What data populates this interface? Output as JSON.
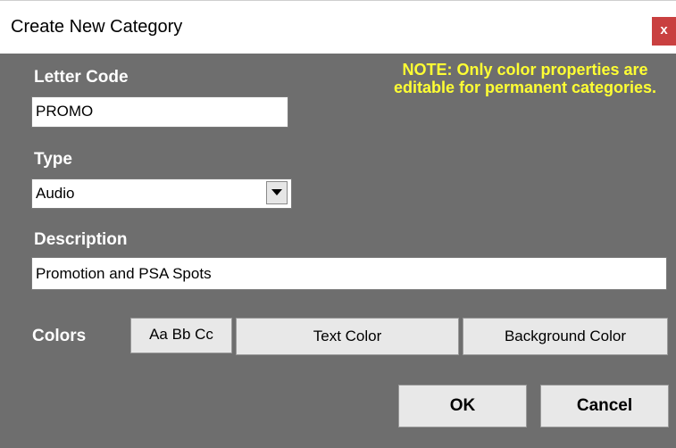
{
  "window": {
    "title": "Create New Category",
    "close_label": "x"
  },
  "form": {
    "letter_code_label": "Letter Code",
    "letter_code_value": "PROMO",
    "note": "NOTE: Only color properties are editable for permanent categories.",
    "type_label": "Type",
    "type_value": "Audio",
    "description_label": "Description",
    "description_value": "Promotion and PSA Spots",
    "colors_label": "Colors",
    "preview_text": "Aa Bb Cc",
    "text_color_label": "Text Color",
    "background_color_label": "Background Color"
  },
  "buttons": {
    "ok": "OK",
    "cancel": "Cancel"
  },
  "colors": {
    "client_bg": "#6e6e6e",
    "note": "#ffff33",
    "close_bg": "#c94040"
  },
  "icons": {
    "close": "close-icon",
    "dropdown": "chevron-down-icon"
  }
}
